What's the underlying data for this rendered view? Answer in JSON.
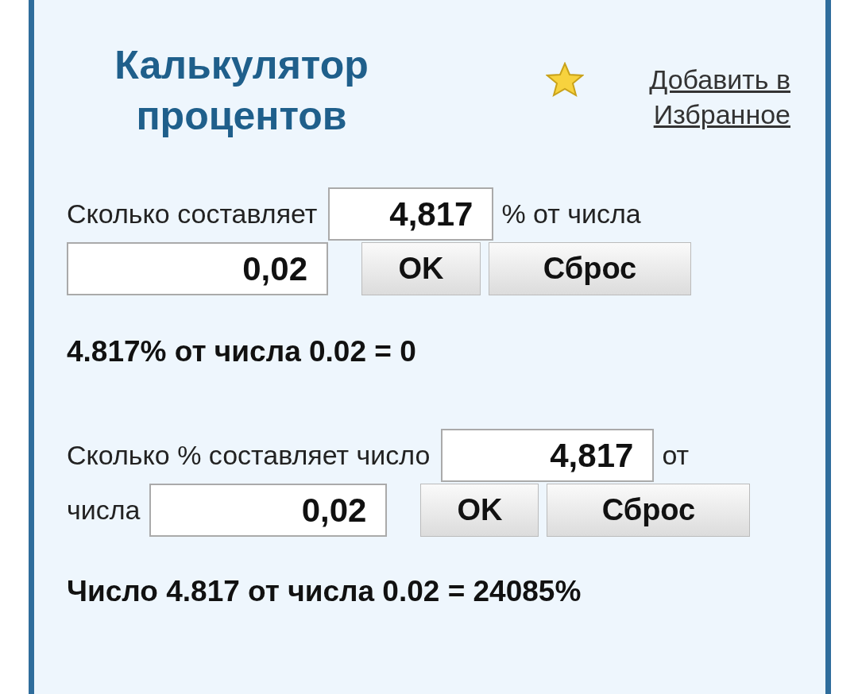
{
  "title": "Калькулятор процентов",
  "favorite_link": "Добавить в Избранное",
  "calculators": [
    {
      "line_1": {
        "before": "Сколько составляет",
        "value": "4,817",
        "after": "% от числа"
      },
      "line_2": {
        "value": "0,02"
      },
      "ok_button": "OK",
      "reset_button": "Сброс",
      "result": "4.817% от числа 0.02 = 0"
    },
    {
      "line_1": {
        "before": "Сколько % составляет число",
        "value": "4,817",
        "after": "от"
      },
      "line_2": {
        "before": "числа",
        "value": "0,02"
      },
      "ok_button": "OK",
      "reset_button": "Сброс",
      "result": "Число 4.817 от числа 0.02 = 24085%"
    }
  ]
}
